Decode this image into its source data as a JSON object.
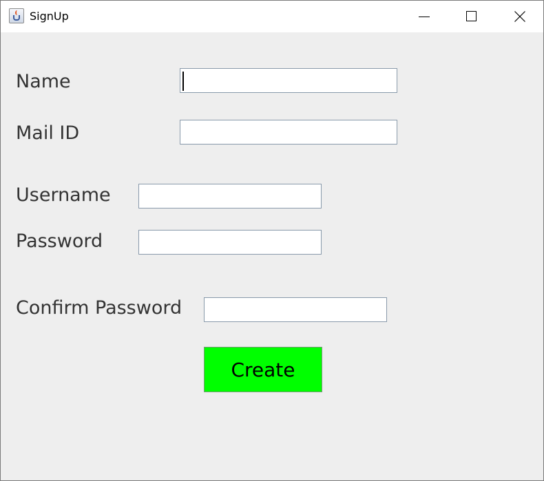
{
  "window": {
    "title": "SignUp",
    "app_icon": "java-icon",
    "controls": [
      "minimize-icon",
      "maximize-icon",
      "close-icon"
    ]
  },
  "form": {
    "name_label": "Name",
    "name_value": "",
    "mail_label": "Mail ID",
    "mail_value": "",
    "username_label": "Username",
    "username_value": "",
    "password_label": "Password",
    "password_value": "",
    "confirm_label": "Confirm Password",
    "confirm_value": "",
    "create_label": "Create"
  },
  "colors": {
    "create_button": "#00ff00",
    "background": "#eeeeee"
  }
}
